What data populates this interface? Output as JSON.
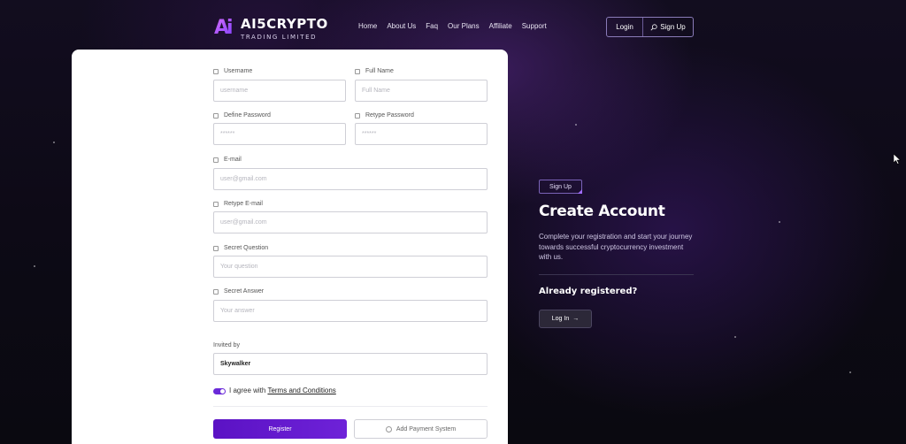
{
  "brand": {
    "logo_mark": "Ai",
    "title": "AI5CRYPTO",
    "subtitle": "TRADING LIMITED"
  },
  "nav": {
    "items": [
      "Home",
      "About Us",
      "Faq",
      "Our Plans",
      "Affiliate",
      "Support"
    ]
  },
  "auth": {
    "login": "Login",
    "signup": "Sign Up"
  },
  "form": {
    "username": {
      "label": "Username",
      "placeholder": "username"
    },
    "fullname": {
      "label": "Full Name",
      "placeholder": "Full Name"
    },
    "password": {
      "label": "Define Password",
      "placeholder": "******"
    },
    "retype_password": {
      "label": "Retype Password",
      "placeholder": "******"
    },
    "email": {
      "label": "E-mail",
      "placeholder": "user@gmail.com"
    },
    "retype_email": {
      "label": "Retype E-mail",
      "placeholder": "user@gmail.com"
    },
    "secret_question": {
      "label": "Secret Question",
      "placeholder": "Your question"
    },
    "secret_answer": {
      "label": "Secret Answer",
      "placeholder": "Your answer"
    },
    "invited_by": {
      "label": "Invited by",
      "value": "Skywalker"
    },
    "agree_prefix": "I agree with",
    "agree_link": "Terms and Conditions",
    "agree_checked": true,
    "register_label": "Register",
    "add_payment_label": "Add Payment System"
  },
  "panel": {
    "badge": "Sign Up",
    "title": "Create Account",
    "description": "Complete your registration and start your journey towards successful cryptocurrency investment with us.",
    "already": "Already registered?",
    "login_button": "Log In"
  },
  "colors": {
    "accent": "#6a2ad8",
    "background": "#0b0a12"
  }
}
